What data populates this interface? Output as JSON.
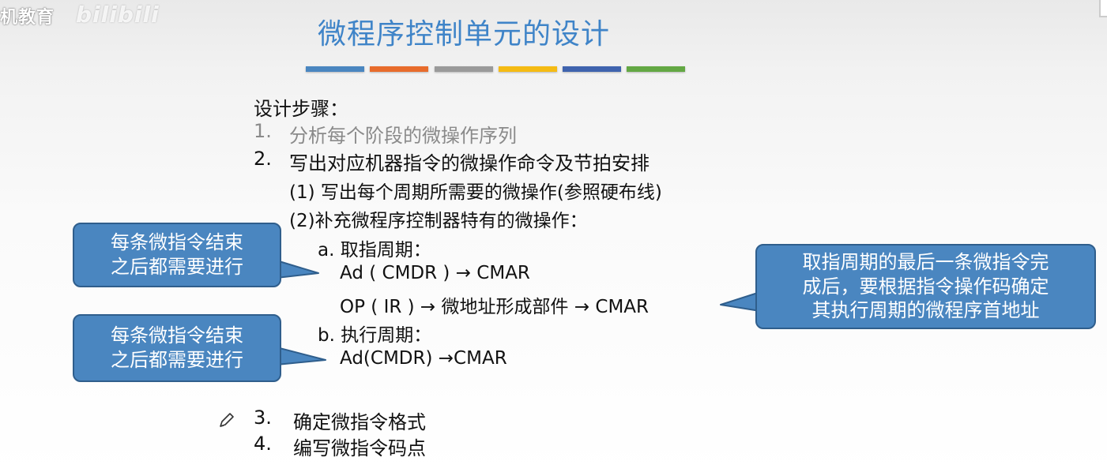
{
  "watermark": {
    "text": "机教育",
    "logo_text": "bilibili"
  },
  "title": "微程序控制单元的设计",
  "colors": {
    "title": "#3f84c8",
    "callout_fill": "#4a86c0",
    "callout_border": "#2f5e8c",
    "bars": [
      "#4a86c0",
      "#e86c2c",
      "#9a9a9a",
      "#f5bb14",
      "#3f63ae",
      "#63a844"
    ]
  },
  "steps": {
    "heading": "设计步骤：",
    "s1_num": "1.",
    "s1_text": "分析每个阶段的微操作序列",
    "s2_num": "2.",
    "s2_text": "写出对应机器指令的微操作命令及节拍安排",
    "s2_sub1": "(1) 写出每个周期所需要的微操作(参照硬布线)",
    "s2_sub2": "(2)补充微程序控制器特有的微操作：",
    "a_label": "a. 取指周期：",
    "a_line1": "Ad ( CMDR ) → CMAR",
    "a_line2": "OP ( IR ) → 微地址形成部件 → CMAR",
    "b_label": "b. 执行周期：",
    "b_line1": "Ad(CMDR) →CMAR",
    "s3_num": "3.",
    "s3_text": "确定微指令格式",
    "s4_num": "4.",
    "s4_text": "编写微指令码点"
  },
  "callouts": {
    "left_top": "每条微指令结束\n之后都需要进行",
    "left_bottom": "每条微指令结束\n之后都需要进行",
    "right": "取指周期的最后一条微指令完\n成后，要根据指令操作码确定\n其执行周期的微程序首地址"
  },
  "icons": {
    "pencil": "pencil-icon"
  }
}
